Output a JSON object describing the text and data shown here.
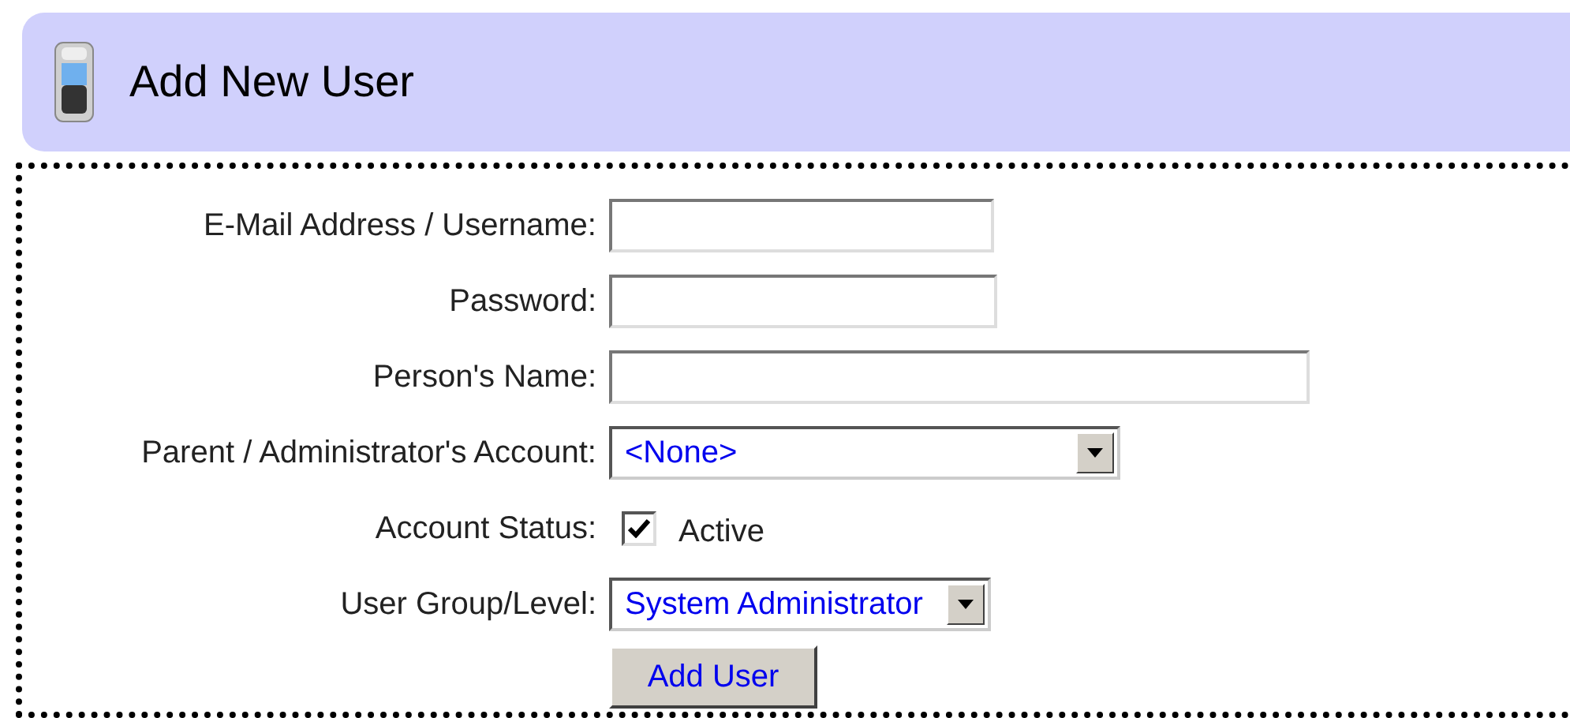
{
  "header": {
    "title": "Add New User"
  },
  "fields": [
    {
      "kind": "text",
      "label": "E-Mail Address / Username:"
    },
    {
      "kind": "text",
      "label": "Password:"
    },
    {
      "kind": "text",
      "label": "Person's Name:"
    },
    {
      "kind": "select",
      "label": "Parent / Administrator's Account:",
      "value": "<None>"
    },
    {
      "kind": "checkbox",
      "label": "Account Status:",
      "option": "Active",
      "checked": true
    },
    {
      "kind": "select",
      "label": "User Group/Level:",
      "value": "System Administrator"
    }
  ],
  "submit": {
    "label": "Add User"
  }
}
